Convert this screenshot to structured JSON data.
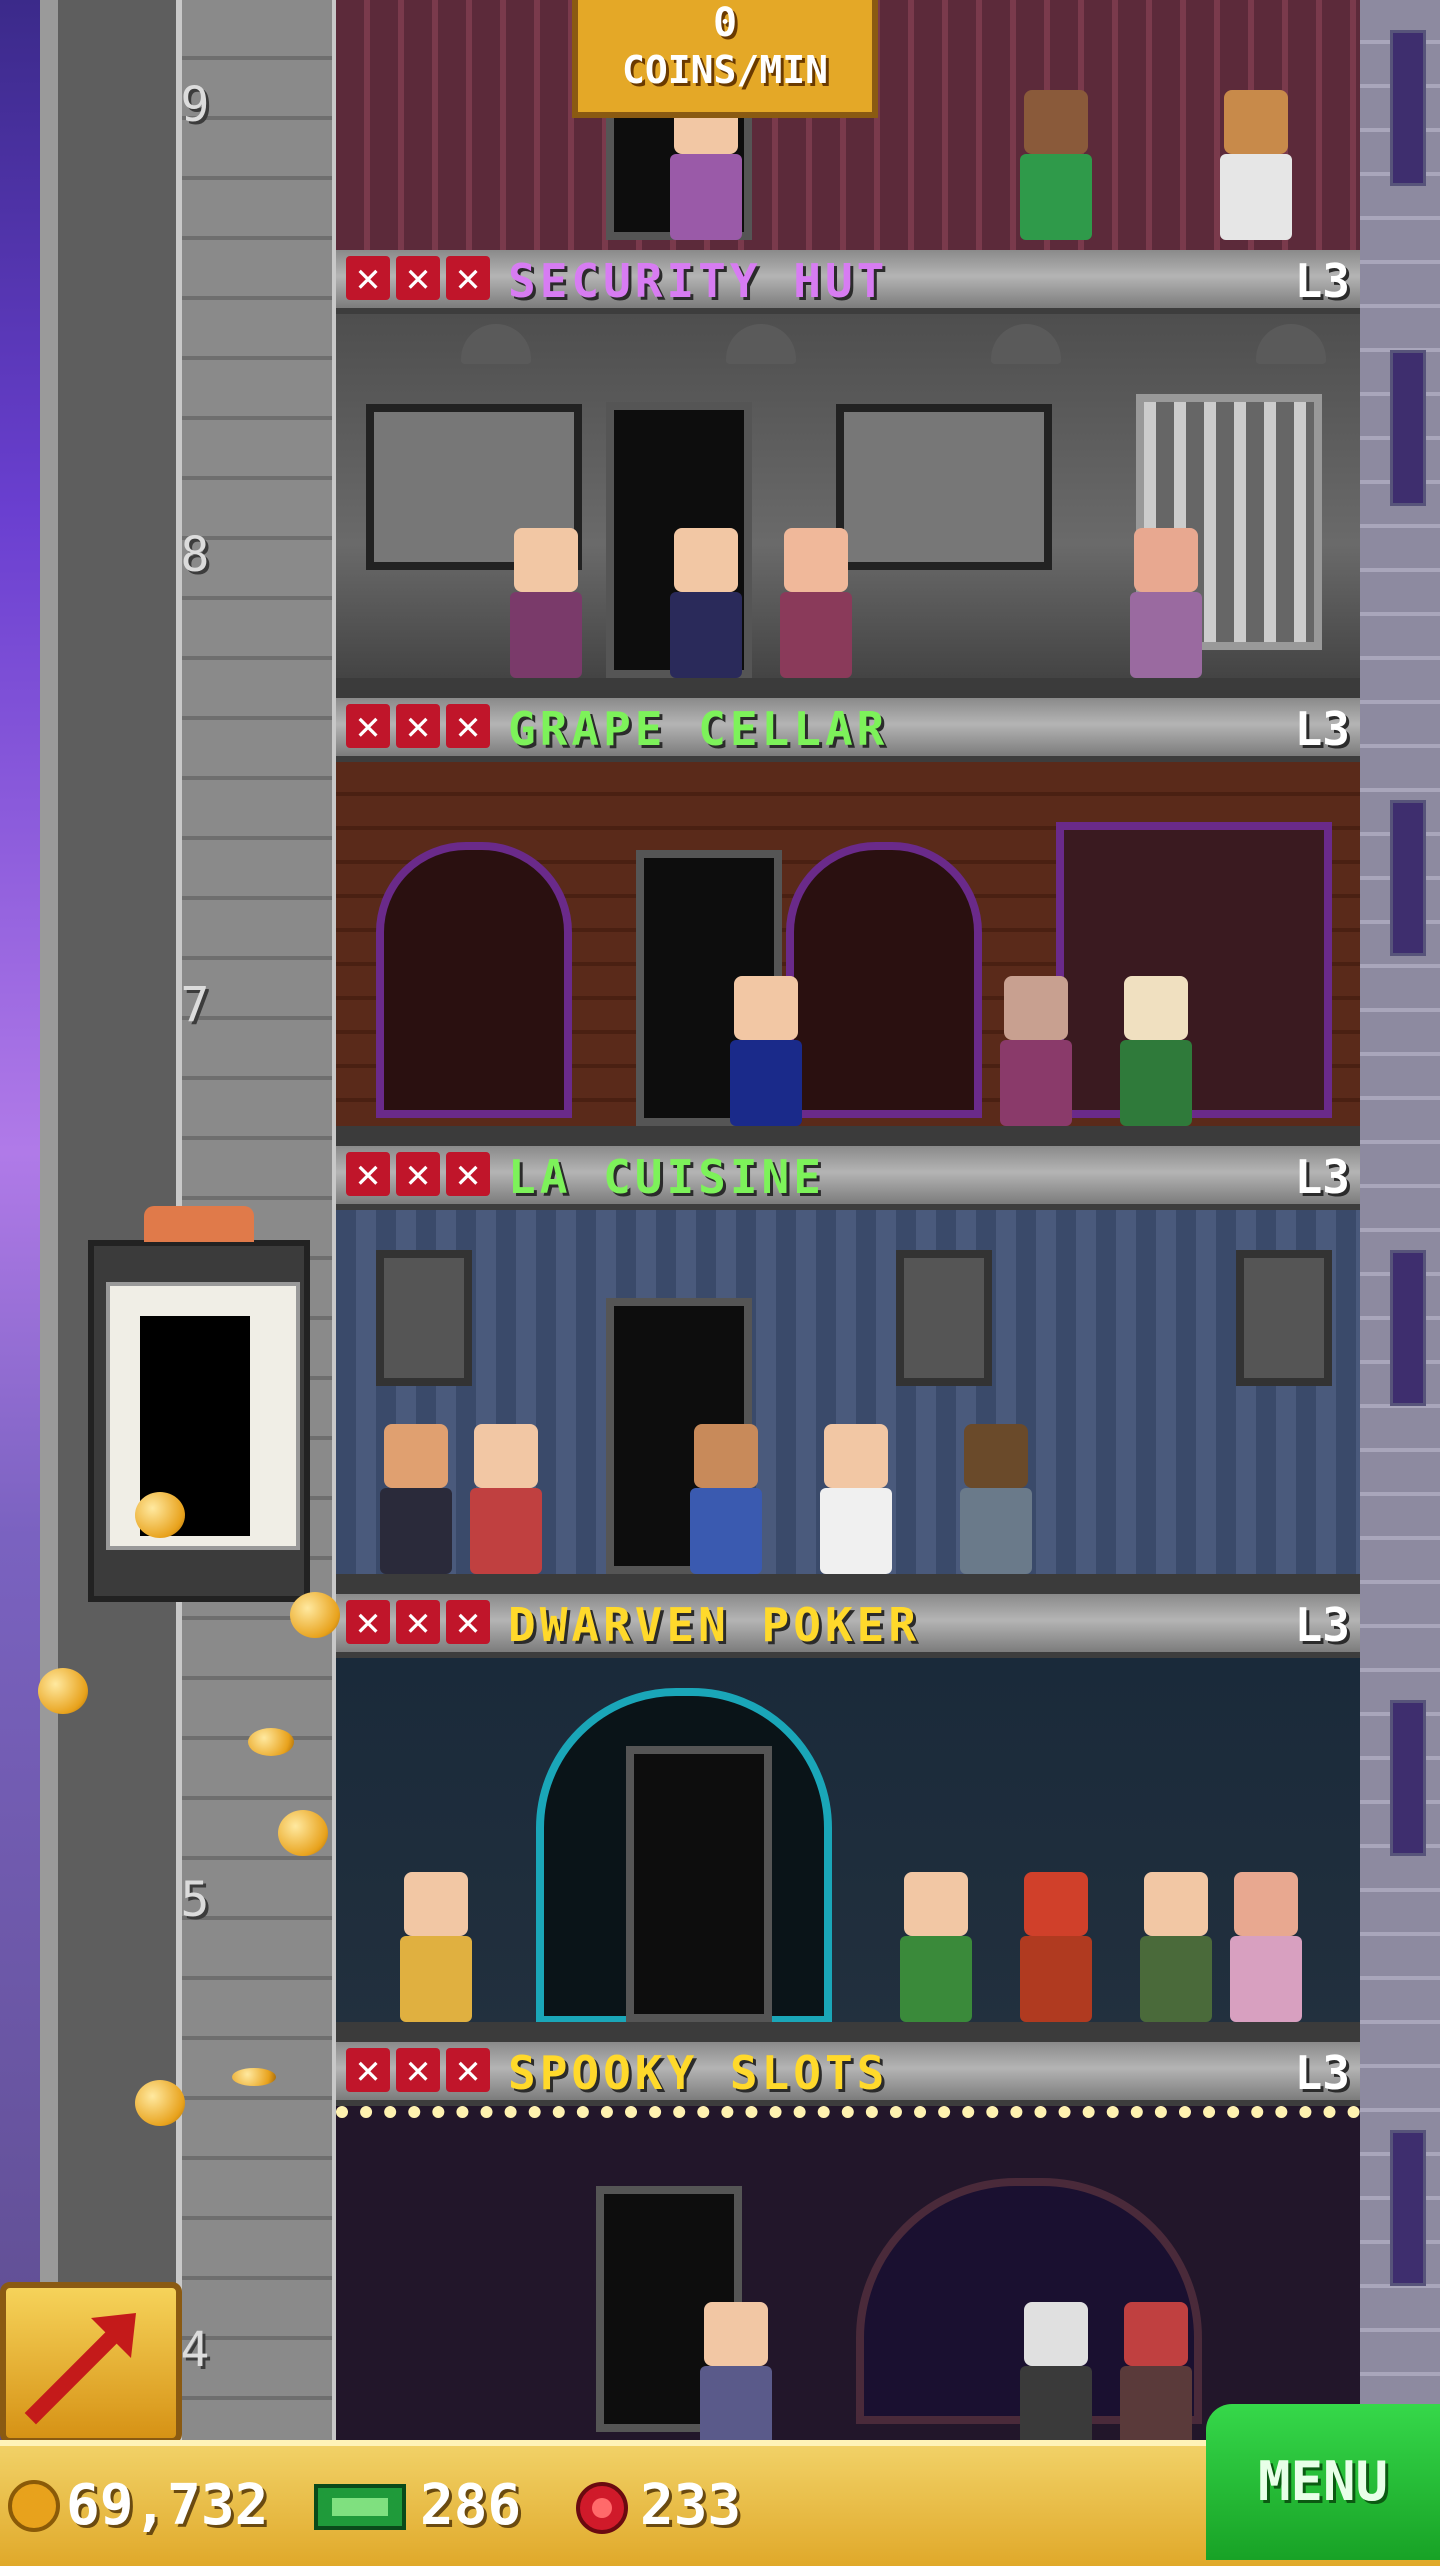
{
  "top_floor": {
    "coins_per_min_value": "0",
    "coins_per_min_label": "COINS/MIN"
  },
  "floor_numbers": [
    "9",
    "8",
    "7",
    "5",
    "4"
  ],
  "floors": [
    {
      "name": "SECURITY HUT",
      "level": "L3",
      "name_color": "#d77cf2"
    },
    {
      "name": "GRAPE CELLAR",
      "level": "L3",
      "name_color": "#7df25a"
    },
    {
      "name": "LA CUISINE",
      "level": "L3",
      "name_color": "#7df25a"
    },
    {
      "name": "DWARVEN POKER",
      "level": "L3",
      "name_color": "#ffd92b"
    },
    {
      "name": "SPOOKY SLOTS",
      "level": "L3",
      "name_color": "#ffd92b"
    }
  ],
  "stock_marks": [
    "✕",
    "✕",
    "✕"
  ],
  "bottom_bar": {
    "coins": "69,732",
    "bux": "286",
    "tokens": "233",
    "menu_label": "MENU"
  },
  "colors": {
    "gold": "#e4a827",
    "menu_green": "#22b530",
    "stock_red": "#c0152a"
  },
  "icons": [
    "coin-icon",
    "bux-icon",
    "token-icon",
    "build-arrow-icon",
    "stock-x-icon"
  ]
}
